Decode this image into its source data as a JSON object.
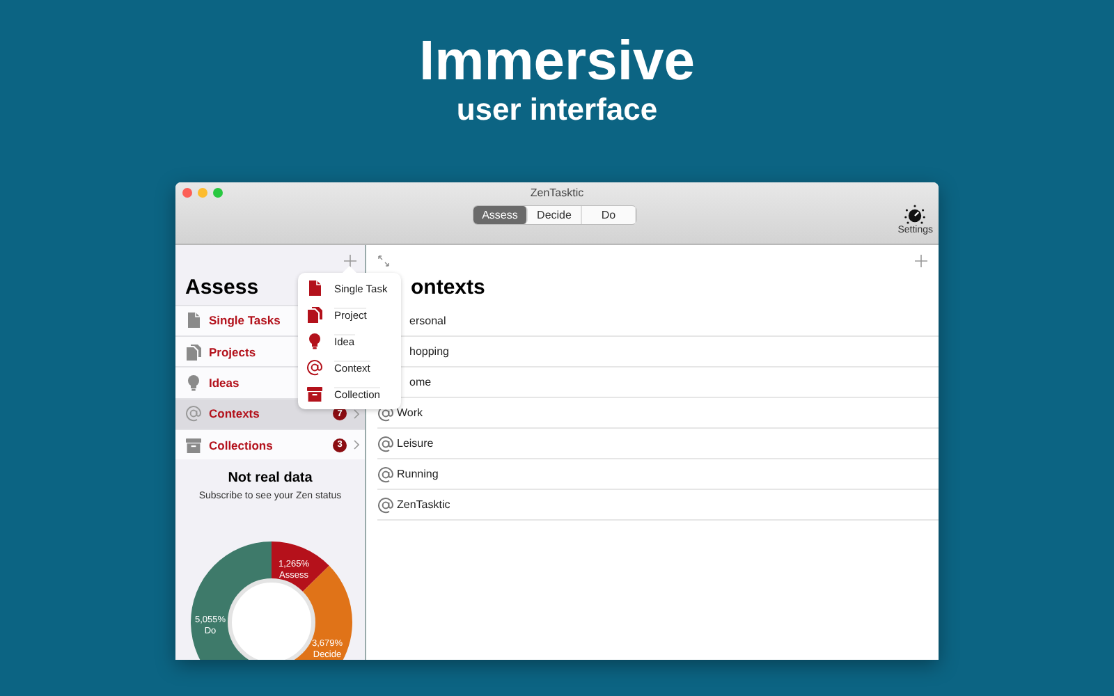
{
  "hero": {
    "title": "Immersive",
    "subtitle": "user interface"
  },
  "window": {
    "title": "ZenTasktic"
  },
  "tabs": [
    {
      "label": "Assess",
      "selected": true
    },
    {
      "label": "Decide",
      "selected": false
    },
    {
      "label": "Do",
      "selected": false
    }
  ],
  "settings": {
    "label": "Settings"
  },
  "sidebar": {
    "title": "Assess",
    "items": [
      {
        "kind": "task",
        "label": "Single Tasks",
        "selected": false
      },
      {
        "kind": "project",
        "label": "Projects",
        "selected": false
      },
      {
        "kind": "idea",
        "label": "Ideas",
        "selected": false
      },
      {
        "kind": "context",
        "label": "Contexts",
        "selected": true,
        "badge": "7"
      },
      {
        "kind": "collection",
        "label": "Collections",
        "selected": false,
        "badge": "3"
      }
    ],
    "status": {
      "title": "Not real data",
      "subtitle": "Subscribe to see your Zen status",
      "chart_data": {
        "type": "donut",
        "categories": [
          "Assess",
          "Decide",
          "Do"
        ],
        "values": [
          12.65,
          36.79,
          50.55
        ],
        "colors": [
          "#b5111b",
          "#e07318",
          "#3e7a6a"
        ],
        "data_labels": true,
        "value_labels": [
          "1,265%",
          "3,679%",
          "5,055%"
        ]
      }
    }
  },
  "add_menu": [
    {
      "kind": "task",
      "label": "Single Task"
    },
    {
      "kind": "project",
      "label": "Project"
    },
    {
      "kind": "idea",
      "label": "Idea"
    },
    {
      "kind": "context",
      "label": "Context"
    },
    {
      "kind": "collection",
      "label": "Collection"
    }
  ],
  "main": {
    "title": "ontexts",
    "rows": [
      {
        "label": "ersonal",
        "covered": true
      },
      {
        "label": "hopping",
        "covered": true
      },
      {
        "label": "ome",
        "covered": true
      },
      {
        "label": "Work",
        "covered": false
      },
      {
        "label": "Leisure",
        "covered": false
      },
      {
        "label": "Running",
        "covered": false
      },
      {
        "label": "ZenTasktic",
        "covered": false
      }
    ]
  }
}
